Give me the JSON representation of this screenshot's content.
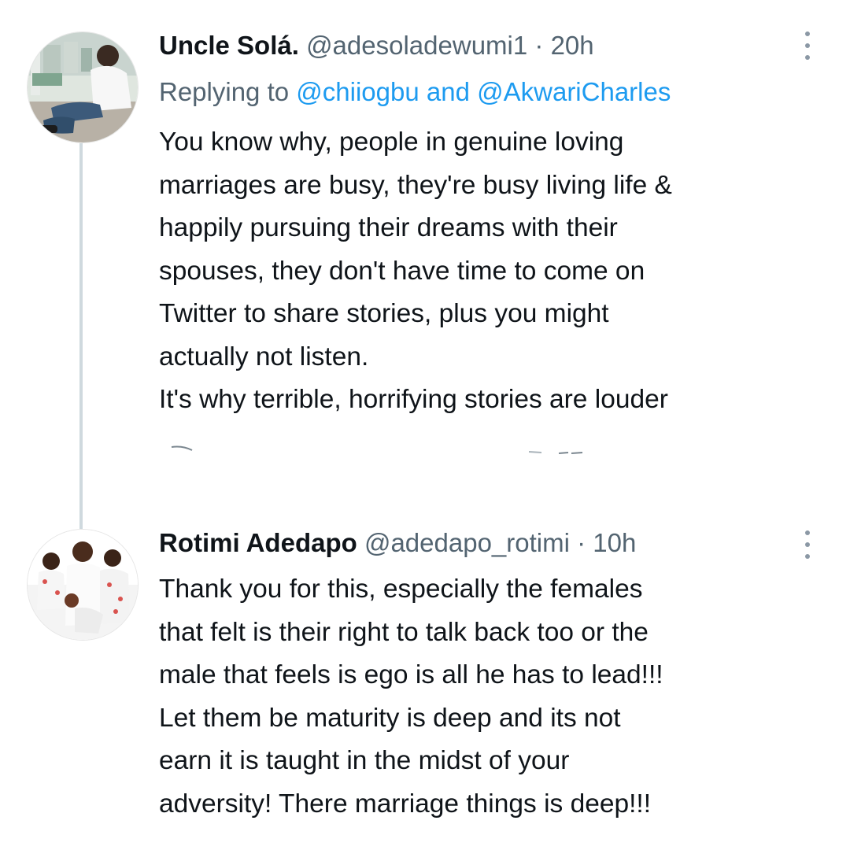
{
  "tweets": [
    {
      "display_name": "Uncle Solá.",
      "handle": "@adesoladewumi1",
      "separator": "·",
      "time": "20h",
      "replying_prefix": "Replying to",
      "replying_mention_1": "@chiiogbu",
      "replying_and": "and",
      "replying_mention_2": "@AkwariCharles",
      "lines": [
        "You know why, people in genuine loving",
        "marriages are busy, they're busy living life &",
        "happily pursuing their dreams with their",
        "spouses, they don't have time to come on",
        "Twitter to share stories, plus you might",
        "actually not listen.",
        "It's why terrible, horrifying stories are louder"
      ]
    },
    {
      "display_name": "Rotimi Adedapo",
      "handle": "@adedapo_rotimi",
      "separator": "·",
      "time": "10h",
      "lines": [
        "Thank you for this, especially the females",
        "that felt is their right to talk back too or the",
        "male that feels is ego is all he has to lead!!!",
        "Let them be maturity is deep and its not",
        "earn it is taught in the midst of your",
        "adversity! There marriage things is deep!!!"
      ]
    }
  ],
  "colors": {
    "text": "#0f1419",
    "secondary": "#536471",
    "link": "#1d9bf0",
    "thread_line": "#cfd9de"
  },
  "icons": {
    "more": "more-vertical-icon",
    "avatar_1": "avatar",
    "avatar_2": "avatar"
  }
}
